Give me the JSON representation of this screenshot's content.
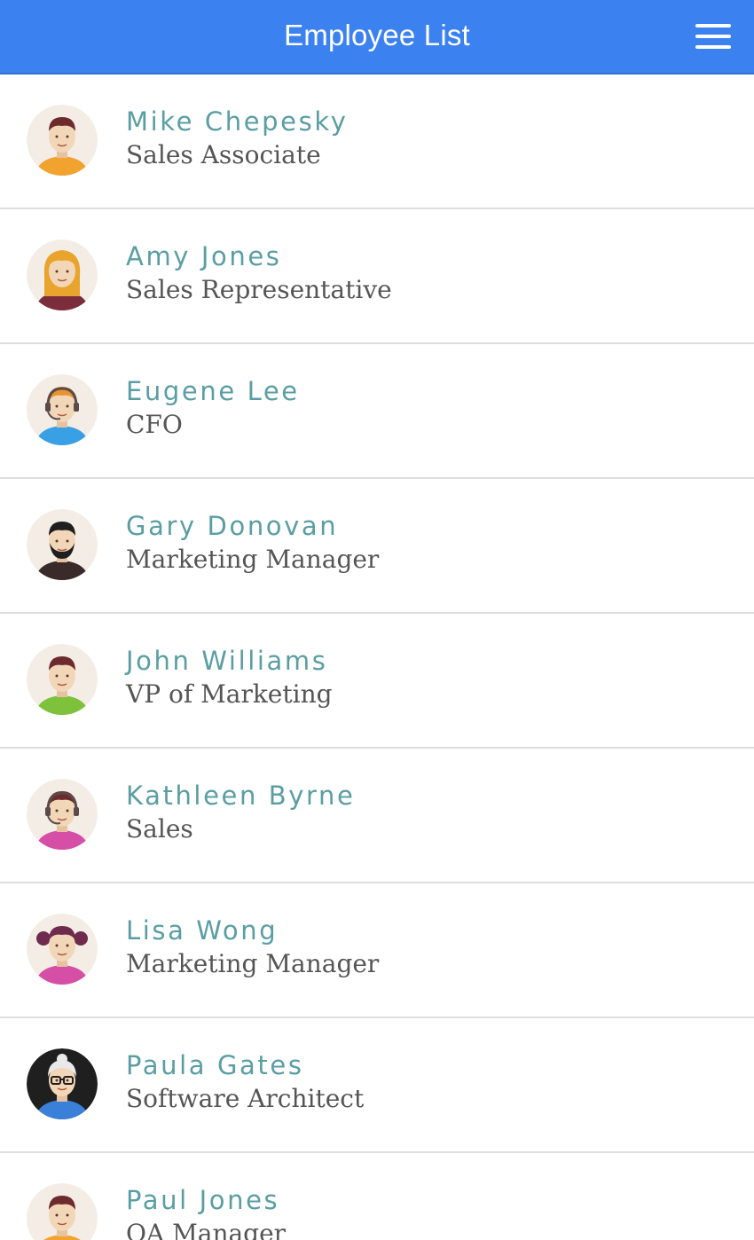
{
  "header": {
    "title": "Employee List",
    "menu_icon": "hamburger-menu-icon",
    "background_color": "#3b82f0"
  },
  "employees": [
    {
      "name": "Mike Chepesky",
      "title": "Sales Associate",
      "avatar_icon": "male-avatar-icon",
      "avatar": {
        "skin": "#f2d6b8",
        "hair": "#6e2b2e",
        "shirt": "#f2a32f",
        "bg": "#f4ede6"
      }
    },
    {
      "name": "Amy Jones",
      "title": "Sales Representative",
      "avatar_icon": "female-avatar-icon",
      "avatar": {
        "skin": "#f2d6b8",
        "hair": "#e8a42d",
        "shirt": "#7b2d3b",
        "bg": "#f4ede6"
      }
    },
    {
      "name": "Eugene Lee",
      "title": "CFO",
      "avatar_icon": "headset-avatar-icon",
      "avatar": {
        "skin": "#f2d6b8",
        "hair": "#e8932d",
        "shirt": "#3aa0e6",
        "bg": "#f4ede6"
      }
    },
    {
      "name": "Gary Donovan",
      "title": "Marketing Manager",
      "avatar_icon": "bearded-avatar-icon",
      "avatar": {
        "skin": "#f2d6b8",
        "hair": "#1f1f1f",
        "shirt": "#3a2a2a",
        "bg": "#f4ede6"
      }
    },
    {
      "name": "John Williams",
      "title": "VP of Marketing",
      "avatar_icon": "male-avatar-icon",
      "avatar": {
        "skin": "#f2d6b8",
        "hair": "#6e2b2e",
        "shirt": "#7dc23a",
        "bg": "#f4ede6"
      }
    },
    {
      "name": "Kathleen Byrne",
      "title": "Sales",
      "avatar_icon": "headset-avatar-icon",
      "avatar": {
        "skin": "#f2d6b8",
        "hair": "#6e2b2e",
        "shirt": "#d64fa6",
        "bg": "#f4ede6"
      }
    },
    {
      "name": "Lisa Wong",
      "title": "Marketing Manager",
      "avatar_icon": "pigtails-avatar-icon",
      "avatar": {
        "skin": "#f2d6b8",
        "hair": "#6e2b4e",
        "shirt": "#d64fa6",
        "bg": "#f4ede6"
      }
    },
    {
      "name": "Paula Gates",
      "title": "Software Architect",
      "avatar_icon": "glasses-avatar-icon",
      "avatar": {
        "skin": "#f2d6b8",
        "hair": "#e9e9e9",
        "shirt": "#3a7fd8",
        "bg": "#1f1f1f"
      }
    },
    {
      "name": "Paul Jones",
      "title": "QA Manager",
      "avatar_icon": "male-avatar-icon",
      "avatar": {
        "skin": "#f2d6b8",
        "hair": "#6e2b2e",
        "shirt": "#f2a32f",
        "bg": "#f4ede6"
      }
    }
  ]
}
